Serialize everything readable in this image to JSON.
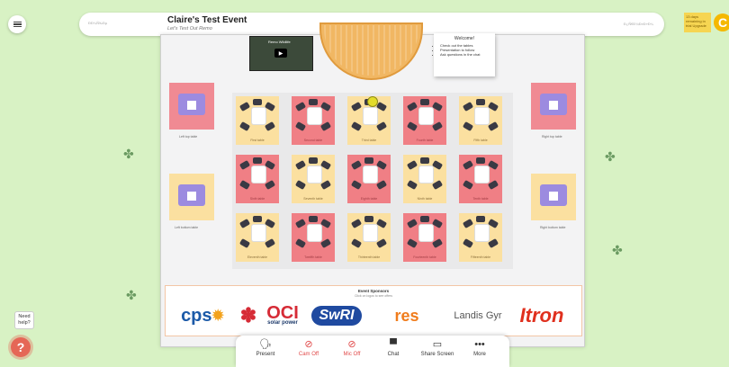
{
  "header": {
    "left_tag": "ĐĐ¼Ñ‰Đµ",
    "title": "Claire's Test Event",
    "subtitle": "Let's Test Out Remo",
    "right_tag": "Đ¿Ñ€Đ¾Đ±Đ»Đ¼"
  },
  "trial": {
    "text": "13 days remaining in trial Upgrade"
  },
  "avatar": {
    "initial": "C"
  },
  "video": {
    "title": "Remo Wildlife"
  },
  "welcome_note": {
    "title": "Welcome!",
    "items": [
      "Check out the tables",
      "Presentation to follow",
      "Ask questions in the chat"
    ]
  },
  "side_tables": {
    "left_top": "Left top table",
    "left_bottom": "Left bottom table",
    "right_top": "Right top table",
    "right_bottom": "Right bottom table"
  },
  "tables": [
    "First table",
    "Second table",
    "Third table",
    "Fourth table",
    "Fifth table",
    "Sixth table",
    "Seventh table",
    "Eighth table",
    "Ninth table",
    "Tenth table",
    "Eleventh table",
    "Twelfth table",
    "Thirteenth table",
    "Fourteenth table",
    "Fifteenth table"
  ],
  "sponsors": {
    "title": "Event Sponsors",
    "subtitle": "Click on logos to see offers",
    "logos": [
      "cps",
      "OCI",
      "SwRI",
      "res",
      "Landis Gyr",
      "Itron"
    ],
    "sub_oci": "solar power",
    "sub_cps": "ENERGY"
  },
  "toolbar": {
    "present": "Present",
    "cam": "Cam Off",
    "mic": "Mic Off",
    "chat": "Chat",
    "share": "Share Screen",
    "more": "More"
  },
  "help": {
    "bubble": "Need help?",
    "icon": "?"
  }
}
